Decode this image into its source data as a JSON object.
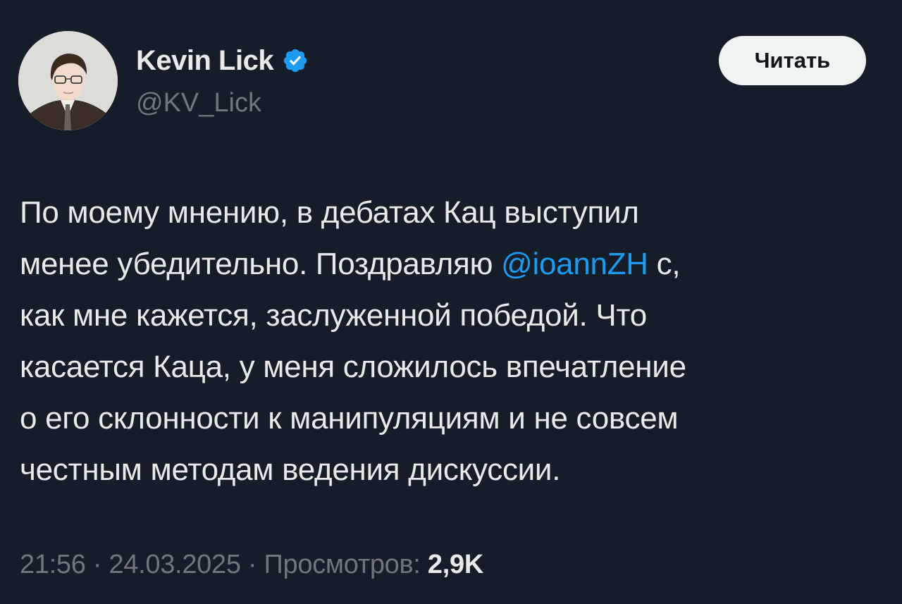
{
  "author": {
    "display_name": "Kevin Lick",
    "handle": "@KV_Lick",
    "verified_icon": "verified-badge-icon",
    "verified_color": "#1d9bf0"
  },
  "follow_button": {
    "label": "Читать"
  },
  "tweet": {
    "lines": [
      {
        "text": "По моему мнению, в дебатах Кац выступил"
      },
      {
        "before": "менее убедительно. Поздравляю ",
        "mention": "@ioannZH",
        "after": " с,"
      },
      {
        "text": "как мне кажется, заслуженной победой. Что"
      },
      {
        "text": "касается Каца, у меня сложилось впечатление"
      },
      {
        "text": "о его склонности к манипуляциям и не совсем"
      },
      {
        "text": "честным методам ведения дискуссии."
      }
    ]
  },
  "meta": {
    "time": "21:56",
    "separator": " · ",
    "date": "24.03.2025",
    "views_label": "Просмотров: ",
    "views_count": "2,9K"
  },
  "colors": {
    "background": "#151d28",
    "text_primary": "#e7e9ea",
    "text_secondary": "#71767b",
    "link": "#1d9bf0",
    "button_bg": "#eff3f4",
    "button_text": "#0f1419"
  }
}
